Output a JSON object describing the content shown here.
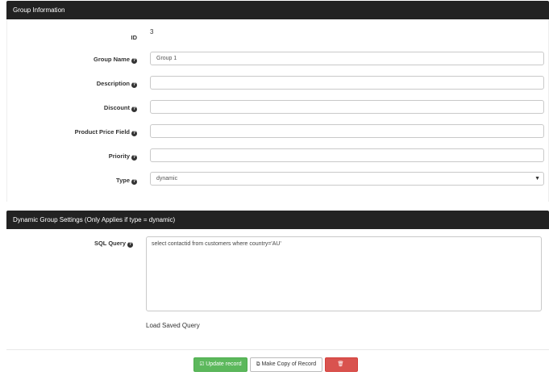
{
  "group_info": {
    "header": "Group Information",
    "id_label": "ID",
    "id_value": "3",
    "fields": {
      "group_name": {
        "label": "Group Name",
        "value": "Group 1"
      },
      "description": {
        "label": "Description",
        "value": ""
      },
      "discount": {
        "label": "Discount",
        "value": ""
      },
      "product_price_field": {
        "label": "Product Price Field",
        "value": ""
      },
      "priority": {
        "label": "Priority",
        "value": ""
      },
      "type": {
        "label": "Type",
        "value": "dynamic"
      }
    }
  },
  "dynamic_settings": {
    "header": "Dynamic Group Settings (Only Applies if type = dynamic)",
    "sql_label": "SQL Query",
    "sql_value": "select contactid from customers where country='AU'",
    "load_saved": "Load Saved Query"
  },
  "actions": {
    "update": "Update record",
    "copy": "Make Copy of Record",
    "delete": "Delete"
  },
  "icons": {
    "help": "question-circle-icon",
    "update": "check-square-icon",
    "copy": "copy-icon",
    "delete": "trash-icon",
    "select": "caret-down-icon"
  },
  "colors": {
    "header_bg": "#222222",
    "success": "#5cb85c",
    "danger": "#d9534f"
  }
}
